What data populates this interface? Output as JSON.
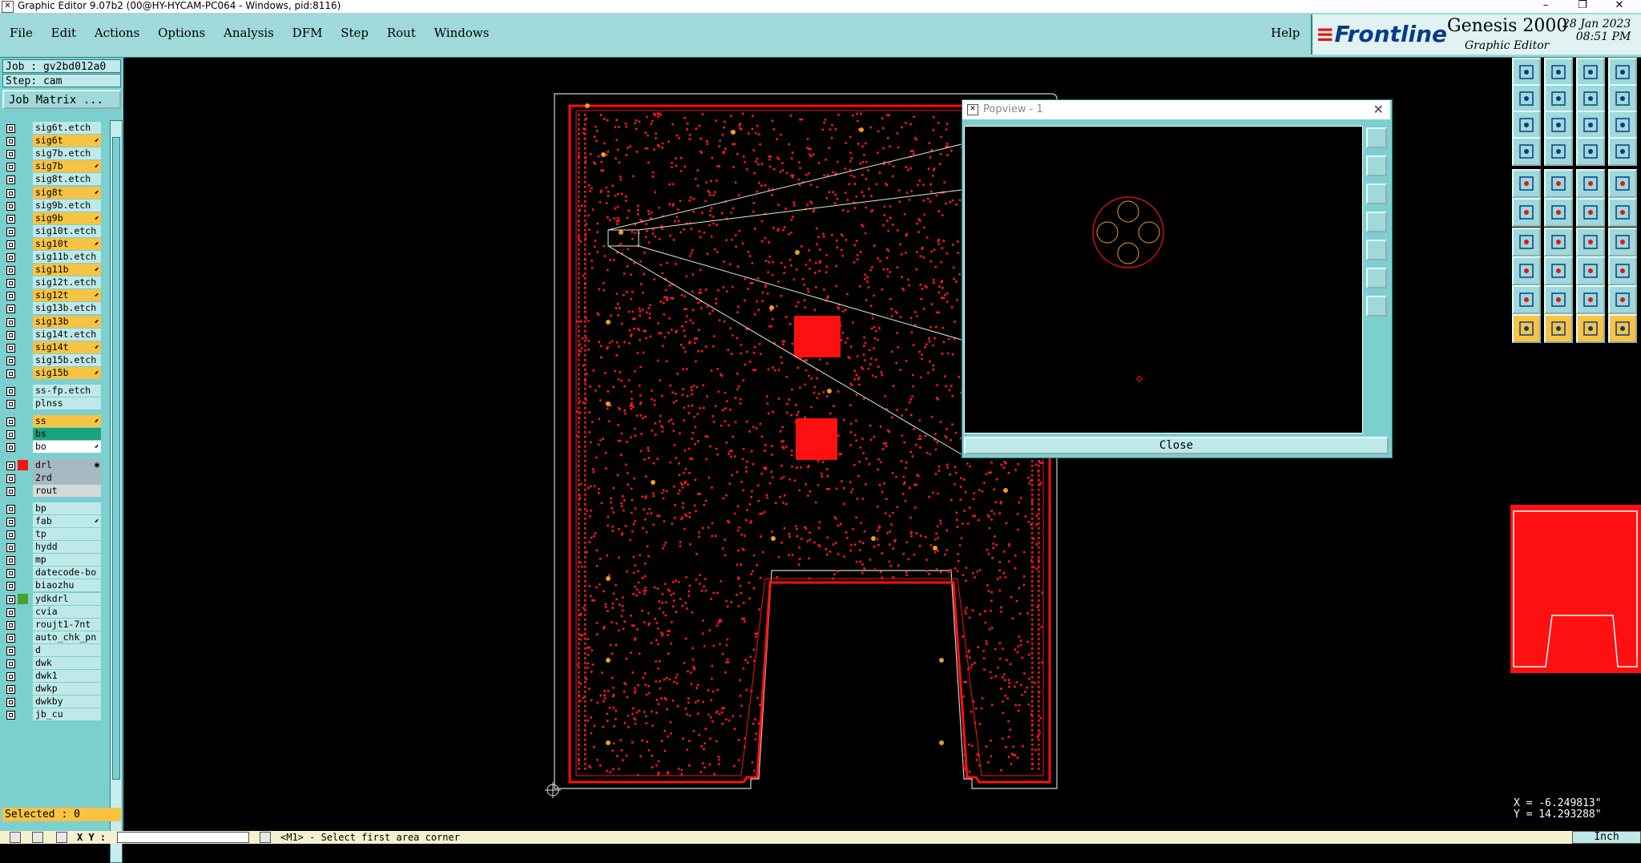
{
  "window": {
    "title": "Graphic Editor 9.07b2 (00@HY-HYCAM-PC064 - Windows, pid:8116)",
    "controls": [
      "–",
      "❐",
      "✕"
    ]
  },
  "menu": {
    "items": [
      "File",
      "Edit",
      "Actions",
      "Options",
      "Analysis",
      "DFM",
      "Step",
      "Rout",
      "Windows"
    ],
    "help": "Help"
  },
  "brand": {
    "logo_text": "Frontline",
    "product": "Genesis 2000",
    "subtitle": "Graphic Editor",
    "date": "28 Jan 2023",
    "time": "08:51 PM"
  },
  "left_panel": {
    "job": "Job : gv2bd012a0",
    "step": "Step: cam",
    "job_matrix_button": "Job Matrix ...",
    "selected": "Selected : 0",
    "layers": [
      {
        "name": "sig6t.etch",
        "bg": "#bfe9e9"
      },
      {
        "name": "sig6t",
        "bg": "#f7c342",
        "mark": "⬋"
      },
      {
        "name": "sig7b.etch",
        "bg": "#bfe9e9"
      },
      {
        "name": "sig7b",
        "bg": "#f7c342",
        "mark": "⬋"
      },
      {
        "name": "sig8t.etch",
        "bg": "#bfe9e9"
      },
      {
        "name": "sig8t",
        "bg": "#f7c342",
        "mark": "⬋"
      },
      {
        "name": "sig9b.etch",
        "bg": "#bfe9e9"
      },
      {
        "name": "sig9b",
        "bg": "#f7c342",
        "mark": "⬋"
      },
      {
        "name": "sig10t.etch",
        "bg": "#bfe9e9"
      },
      {
        "name": "sig10t",
        "bg": "#f7c342",
        "mark": "⬋"
      },
      {
        "name": "sig11b.etch",
        "bg": "#bfe9e9"
      },
      {
        "name": "sig11b",
        "bg": "#f7c342",
        "mark": "⬋"
      },
      {
        "name": "sig12t.etch",
        "bg": "#bfe9e9"
      },
      {
        "name": "sig12t",
        "bg": "#f7c342",
        "mark": "⬋"
      },
      {
        "name": "sig13b.etch",
        "bg": "#bfe9e9"
      },
      {
        "name": "sig13b",
        "bg": "#f7c342",
        "mark": "⬋"
      },
      {
        "name": "sig14t.etch",
        "bg": "#bfe9e9"
      },
      {
        "name": "sig14t",
        "bg": "#f7c342",
        "mark": "⬋"
      },
      {
        "name": "sig15b.etch",
        "bg": "#bfe9e9"
      },
      {
        "name": "sig15b",
        "bg": "#f7c342",
        "mark": "⬋"
      },
      {
        "name": "ss-fp.etch",
        "bg": "#bfe9e9",
        "gap": true
      },
      {
        "name": "plnss",
        "bg": "#bfe9e9"
      },
      {
        "name": "ss",
        "bg": "#f7c342",
        "mark": "⬋",
        "gap": true
      },
      {
        "name": "bs",
        "bg": "#1aa37a"
      },
      {
        "name": "bo",
        "bg": "#ffffff",
        "mark": "⬋"
      },
      {
        "name": "drl",
        "bg": "#a8b8c0",
        "swatch": "#ff1010",
        "mark": "◉",
        "gap": true
      },
      {
        "name": "2rd",
        "bg": "#a8b8c0"
      },
      {
        "name": "rout",
        "bg": "#d8d8d8"
      },
      {
        "name": "bp",
        "bg": "#bfe9e9",
        "gap": true
      },
      {
        "name": "fab",
        "bg": "#bfe9e9",
        "mark": "⬋"
      },
      {
        "name": "tp",
        "bg": "#bfe9e9"
      },
      {
        "name": "hydd",
        "bg": "#bfe9e9"
      },
      {
        "name": "mp",
        "bg": "#bfe9e9"
      },
      {
        "name": "datecode-bo",
        "bg": "#bfe9e9"
      },
      {
        "name": "biaozhu",
        "bg": "#bfe9e9"
      },
      {
        "name": "ydkdrl",
        "bg": "#bfe9e9",
        "swatch": "#4aa02c"
      },
      {
        "name": "cvia",
        "bg": "#bfe9e9"
      },
      {
        "name": "roujt1-7nt",
        "bg": "#bfe9e9"
      },
      {
        "name": "auto_chk_pn",
        "bg": "#bfe9e9"
      },
      {
        "name": "d",
        "bg": "#bfe9e9"
      },
      {
        "name": "dwk",
        "bg": "#bfe9e9"
      },
      {
        "name": "dwk1",
        "bg": "#bfe9e9"
      },
      {
        "name": "dwkp",
        "bg": "#bfe9e9"
      },
      {
        "name": "dwkby",
        "bg": "#bfe9e9"
      },
      {
        "name": "jb_cu",
        "bg": "#bfe9e9"
      }
    ]
  },
  "popview": {
    "title": "Popview - 1",
    "close_button": "Close"
  },
  "right_panel": {
    "coords": {
      "x": "X = -6.249813\"",
      "y": "Y = 14.293288\""
    }
  },
  "status_bar": {
    "xy_label": "X Y :",
    "xy_value": "",
    "message": "<M1> - Select first area corner",
    "unit": "Inch"
  },
  "colors": {
    "accent_teal": "#9fd9d9",
    "board_red": "#ff1010",
    "affected_orange": "#f7c342"
  }
}
